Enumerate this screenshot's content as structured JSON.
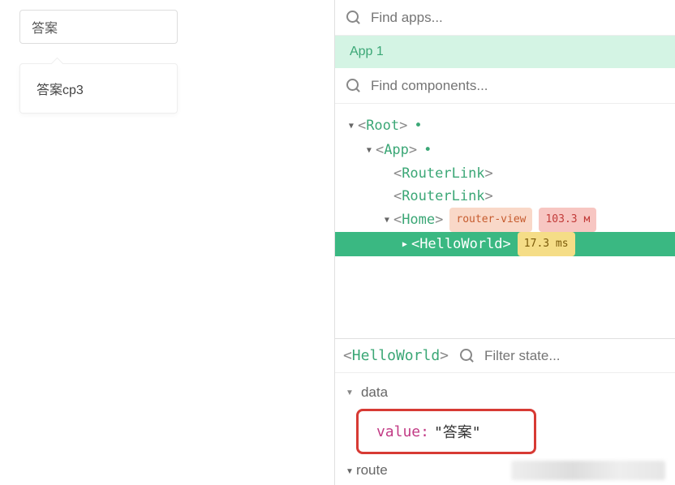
{
  "leftPane": {
    "inputValue": "答案",
    "dropdownOption": "答案cp3"
  },
  "devtools": {
    "findApps": {
      "placeholder": "Find apps..."
    },
    "appLabel": "App 1",
    "findComponents": {
      "placeholder": "Find components..."
    },
    "tree": {
      "root": "Root",
      "app": "App",
      "routerLink1": "RouterLink",
      "routerLink2": "RouterLink",
      "home": "Home",
      "homeBadgeView": "router-view",
      "homeBadgeTime": "103.3 м",
      "helloWorld": "HelloWorld",
      "helloWorldBadgeTime": "17.3 ms"
    },
    "state": {
      "selectedComponent": "HelloWorld",
      "filterPlaceholder": "Filter state...",
      "sections": {
        "data": {
          "label": "data",
          "entryKey": "value",
          "entryValue": "\"答案\""
        },
        "route": {
          "label": "route"
        }
      }
    }
  }
}
